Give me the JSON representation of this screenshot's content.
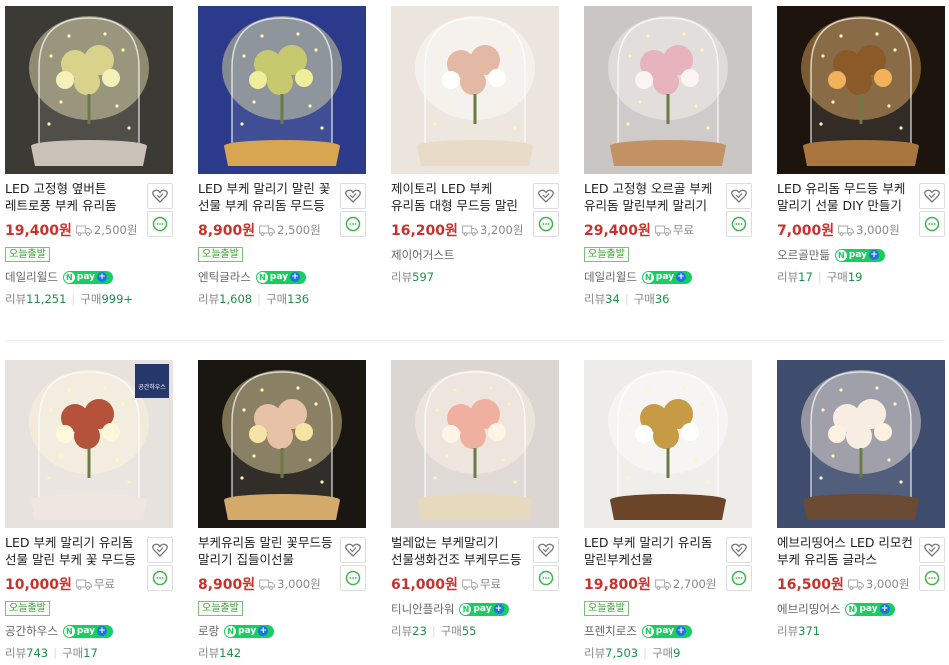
{
  "products": [
    [
      {
        "title": "LED 고정형 옆버튼 레트로풍 부케 유리돔 말린 꽃무드등",
        "price": "19,400원",
        "shipping": "2,500원",
        "today": "오늘출발",
        "seller": "데일리윌드",
        "npay": "pay",
        "review_label": "리뷰",
        "review": "11,251",
        "purchase_label": "구매",
        "purchase": "999+",
        "palette": {
          "bg": "#3c3a35",
          "glow": "#f3f0b8",
          "flower": "#d8d28a",
          "base": "#c9c2b8"
        }
      },
      {
        "title": "LED 부케 말리기 말린 꽃 선물 부케 유리돔 무드등",
        "price": "8,900원",
        "shipping": "2,500원",
        "today": "오늘출발",
        "seller": "엔틱글라스",
        "npay": "pay",
        "review_label": "리뷰",
        "review": "1,608",
        "purchase_label": "구매",
        "purchase": "136",
        "palette": {
          "bg": "#2b3a8a",
          "glow": "#f0ee9a",
          "flower": "#c7c96e",
          "base": "#d8a650"
        }
      },
      {
        "title": "제이토리 LED 부케 유리돔 대형 무드등 말린 꽃",
        "price": "16,200원",
        "shipping": "3,200원",
        "today": "",
        "seller": "제이어거스트",
        "npay": "",
        "review_label": "리뷰",
        "review": "597",
        "purchase_label": "",
        "purchase": "",
        "palette": {
          "bg": "#ebe5dd",
          "glow": "#ffffff",
          "flower": "#e3b9a6",
          "base": "#e8dcc8"
        }
      },
      {
        "title": "LED 고정형 오르골 부케 유리돔 말린부케 말리기",
        "price": "29,400원",
        "shipping": "무료",
        "today": "오늘출발",
        "seller": "데일리윌드",
        "npay": "pay",
        "review_label": "리뷰",
        "review": "34",
        "purchase_label": "구매",
        "purchase": "36",
        "palette": {
          "bg": "#c9c6c4",
          "glow": "#fbf4f2",
          "flower": "#e7b3bc",
          "base": "#c39263"
        }
      },
      {
        "title": "LED 유리돔 무드등 부케 말리기 선물 DIY 만들기",
        "price": "7,000원",
        "shipping": "3,000원",
        "today": "",
        "seller": "오르골만듦",
        "npay": "pay",
        "review_label": "리뷰",
        "review": "17",
        "purchase_label": "구매",
        "purchase": "19",
        "palette": {
          "bg": "#1c140d",
          "glow": "#f2b25a",
          "flower": "#8a5a28",
          "base": "#a9763f"
        }
      }
    ],
    [
      {
        "title": "LED 부케 말리기 유리돔 선물 말린 부케 꽃 무드등",
        "price": "10,000원",
        "shipping": "무료",
        "today": "오늘출발",
        "seller": "공간하우스",
        "npay": "pay",
        "review_label": "리뷰",
        "review": "743",
        "purchase_label": "구매",
        "purchase": "17",
        "corner_logo": "공간하우스",
        "palette": {
          "bg": "#e8e2de",
          "glow": "#fff7da",
          "flower": "#b4523a",
          "base": "#efe7df"
        }
      },
      {
        "title": "부케유리돔 말린 꽃무드등 말리기 집들이선물",
        "price": "8,900원",
        "shipping": "3,000원",
        "today": "오늘출발",
        "seller": "로랑",
        "npay": "pay",
        "review_label": "리뷰",
        "review": "142",
        "purchase_label": "",
        "purchase": "",
        "palette": {
          "bg": "#1a1611",
          "glow": "#f7e3a4",
          "flower": "#e7c2a6",
          "base": "#d4aa6b"
        }
      },
      {
        "title": "벌레없는 부케말리기 선물생화건조 부케무드등",
        "price": "61,000원",
        "shipping": "무료",
        "today": "",
        "seller": "티니안플라워",
        "npay": "pay",
        "review_label": "리뷰",
        "review": "23",
        "purchase_label": "구매",
        "purchase": "55",
        "palette": {
          "bg": "#dcd6d2",
          "glow": "#fff4e6",
          "flower": "#f0b0a0",
          "base": "#e6d9bd"
        }
      },
      {
        "title": "LED 부케 말리기 유리돔 말린부케선물",
        "price": "19,800원",
        "shipping": "2,700원",
        "today": "오늘출발",
        "seller": "프렌치로즈",
        "npay": "pay",
        "review_label": "리뷰",
        "review": "7,503",
        "purchase_label": "구매",
        "purchase": "9",
        "palette": {
          "bg": "#eeece8",
          "glow": "#ffffff",
          "flower": "#c79a45",
          "base": "#6a4528"
        }
      },
      {
        "title": "에브리띵어스 LED 리모컨 부케 유리돔 글라스 무드등",
        "price": "16,500원",
        "shipping": "3,000원",
        "today": "",
        "seller": "에브리띵어스",
        "npay": "pay",
        "review_label": "리뷰",
        "review": "371",
        "purchase_label": "",
        "purchase": "",
        "palette": {
          "bg": "#3e4c6e",
          "glow": "#fff1e0",
          "flower": "#f8ede2",
          "base": "#6b4a33"
        }
      }
    ]
  ]
}
